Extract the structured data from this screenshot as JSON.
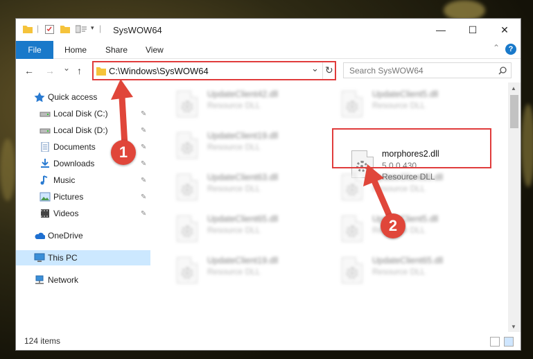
{
  "window": {
    "title": "SysWOW64",
    "controls": {
      "minimize": "—",
      "maximize": "☐",
      "close": "✕"
    }
  },
  "ribbon": {
    "tabs": [
      "File",
      "Home",
      "Share",
      "View"
    ],
    "help": "?",
    "collapse": "⌃"
  },
  "address_bar": {
    "path": "C:\\Windows\\SysWOW64",
    "dropdown": "⌄",
    "refresh": "↻"
  },
  "search": {
    "placeholder": "Search SysWOW64",
    "icon": "search-icon"
  },
  "nav": {
    "back": "←",
    "forward": "→",
    "recent": "⌄",
    "up": "↑"
  },
  "sidebar": {
    "items": [
      {
        "label": "Quick access",
        "icon": "star-icon"
      },
      {
        "label": "Local Disk (C:)",
        "icon": "drive-icon",
        "pin": "📌"
      },
      {
        "label": "Local Disk (D:)",
        "icon": "drive-icon",
        "pin": "📌"
      },
      {
        "label": "Documents",
        "icon": "documents-icon",
        "pin": "📌"
      },
      {
        "label": "Downloads",
        "icon": "download-icon",
        "pin": "📌"
      },
      {
        "label": "Music",
        "icon": "music-icon",
        "pin": "📌"
      },
      {
        "label": "Pictures",
        "icon": "pictures-icon",
        "pin": "📌"
      },
      {
        "label": "Videos",
        "icon": "videos-icon",
        "pin": "📌"
      },
      {
        "label": "OneDrive",
        "icon": "cloud-icon"
      },
      {
        "label": "This PC",
        "icon": "computer-icon",
        "selected": true
      },
      {
        "label": "Network",
        "icon": "network-icon"
      }
    ]
  },
  "files": [
    {
      "name": "UpdateClient42.dll",
      "type": "Resource DLL"
    },
    {
      "name": "UpdateClient5.dll",
      "type": "Resource DLL"
    },
    {
      "name": "UpdateClient19.dll",
      "type": "Resource DLL"
    },
    {
      "name": "morphores2.dll",
      "version": "5.0.0.430",
      "type": "Resource DLL"
    },
    {
      "name": "UpdateClient63.dll",
      "type": "Resource DLL"
    },
    {
      "name": "UpdateClient65.dll",
      "type": "Resource DLL"
    },
    {
      "name": "UpdateClient65.dll",
      "type": "Resource DLL"
    },
    {
      "name": "UpdateClient5.dll",
      "type": "Resource DLL"
    },
    {
      "name": "UpdateClient19.dll",
      "type": "Resource DLL"
    },
    {
      "name": "UpdateClient65.dll",
      "type": "Resource DLL"
    }
  ],
  "status": {
    "count": "124 items"
  },
  "annotations": {
    "step1": "1",
    "step2": "2"
  },
  "colors": {
    "accent": "#1979ca",
    "highlight": "#e03b3b",
    "badge": "#e0463a",
    "selected": "#cce8ff"
  }
}
